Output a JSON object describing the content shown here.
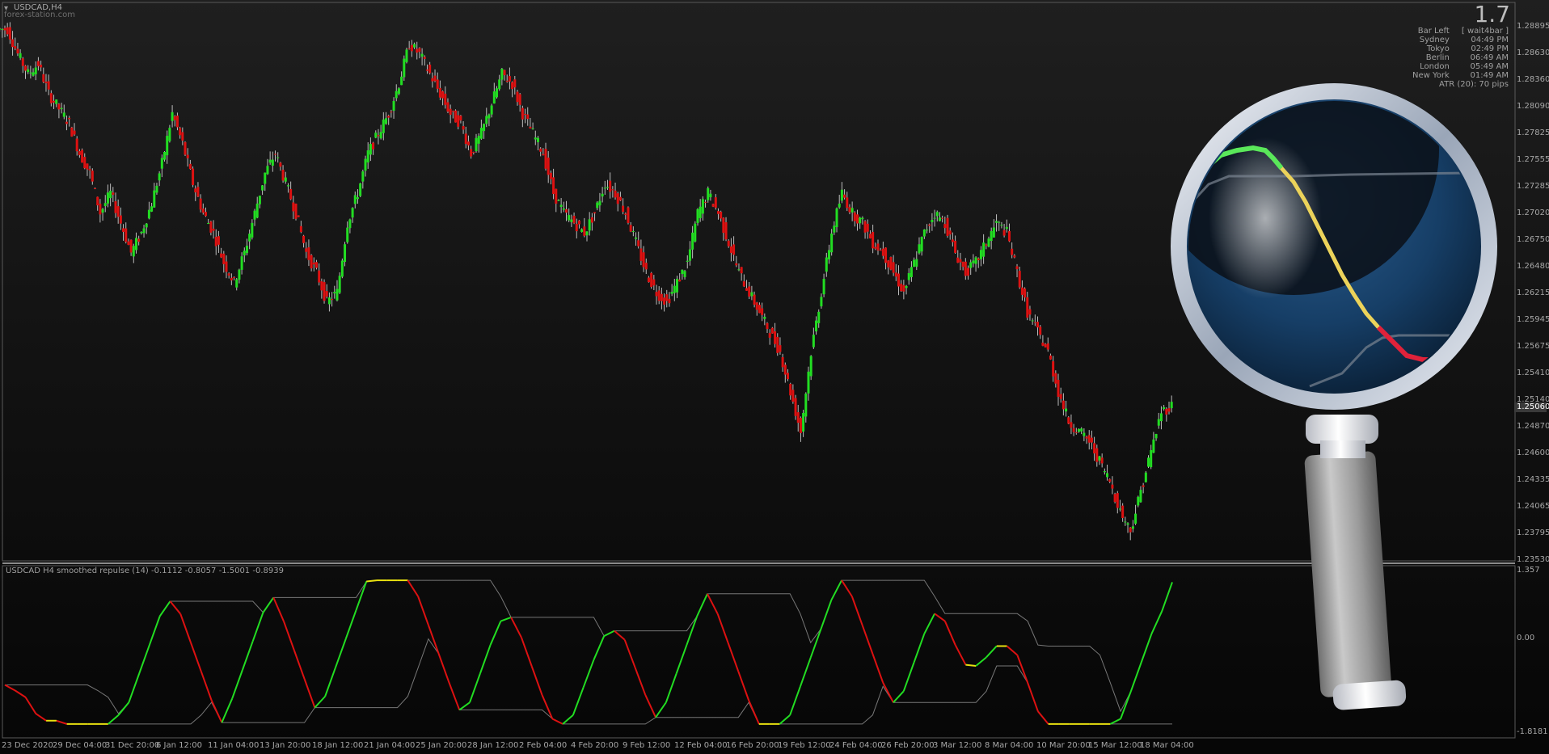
{
  "window": {
    "symbol_title": "USDCAD,H4",
    "watermark": "forex-station.com",
    "countdown": "1.7",
    "current_price": "1.25060"
  },
  "info_panel": [
    {
      "label": "Bar Left",
      "value": "[ wait4bar ]"
    },
    {
      "label": "Sydney",
      "value": "04:49 PM"
    },
    {
      "label": "Tokyo",
      "value": "02:49 PM"
    },
    {
      "label": "Berlin",
      "value": "06:49 AM"
    },
    {
      "label": "London",
      "value": "05:49 AM"
    },
    {
      "label": "New York",
      "value": "01:49 AM"
    }
  ],
  "atr_text": "ATR (20): 70 pips",
  "price_axis": [
    "1.28895",
    "1.28630",
    "1.28360",
    "1.28090",
    "1.27825",
    "1.27555",
    "1.27285",
    "1.27020",
    "1.26750",
    "1.26480",
    "1.26215",
    "1.25945",
    "1.25675",
    "1.25410",
    "1.25140",
    "1.24870",
    "1.24600",
    "1.24335",
    "1.24065",
    "1.23795",
    "1.23530"
  ],
  "indicator": {
    "title": "USDCAD H4 smoothed repulse (14) -0.1112 -0.8057 -1.5001 -0.8939",
    "axis": [
      "1.357",
      "0.00",
      "-1.8181"
    ]
  },
  "time_axis": [
    "23 Dec 2020",
    "29 Dec 04:00",
    "31 Dec 20:00",
    "6 Jan 12:00",
    "11 Jan 04:00",
    "13 Jan 20:00",
    "18 Jan 12:00",
    "21 Jan 04:00",
    "25 Jan 20:00",
    "28 Jan 12:00",
    "2 Feb 04:00",
    "4 Feb 20:00",
    "9 Feb 12:00",
    "12 Feb 04:00",
    "16 Feb 20:00",
    "19 Feb 12:00",
    "24 Feb 04:00",
    "26 Feb 20:00",
    "3 Mar 12:00",
    "8 Mar 04:00",
    "10 Mar 20:00",
    "15 Mar 12:00",
    "18 Mar 04:00"
  ],
  "colors": {
    "bull": "#22dd22",
    "bear": "#dd1111",
    "neutral": "#e8e010",
    "axis_text": "#a7a7a7",
    "lens_blue": "#1b4770"
  },
  "icons": {
    "collapse": "triangle-down-icon",
    "overlay": "magnifying-glass-icon"
  },
  "chart_data": {
    "type": "candlestick",
    "symbol": "USDCAD",
    "timeframe": "H4",
    "price_range": [
      1.2353,
      1.289
    ],
    "last_price": 1.2506,
    "closes": [
      1.2885,
      1.286,
      1.284,
      1.285,
      1.282,
      1.2805,
      1.279,
      1.276,
      1.274,
      1.27,
      1.272,
      1.269,
      1.266,
      1.268,
      1.271,
      1.275,
      1.28,
      1.277,
      1.273,
      1.27,
      1.268,
      1.265,
      1.263,
      1.266,
      1.27,
      1.274,
      1.276,
      1.273,
      1.27,
      1.266,
      1.264,
      1.261,
      1.262,
      1.269,
      1.272,
      1.276,
      1.278,
      1.28,
      1.283,
      1.287,
      1.286,
      1.284,
      1.282,
      1.28,
      1.279,
      1.276,
      1.278,
      1.281,
      1.284,
      1.283,
      1.28,
      1.278,
      1.276,
      1.272,
      1.27,
      1.269,
      1.268,
      1.27,
      1.273,
      1.272,
      1.27,
      1.267,
      1.264,
      1.262,
      1.261,
      1.263,
      1.265,
      1.27,
      1.272,
      1.27,
      1.267,
      1.264,
      1.262,
      1.26,
      1.258,
      1.256,
      1.252,
      1.248,
      1.256,
      1.262,
      1.268,
      1.272,
      1.27,
      1.269,
      1.267,
      1.266,
      1.264,
      1.262,
      1.265,
      1.268,
      1.27,
      1.269,
      1.266,
      1.264,
      1.265,
      1.267,
      1.269,
      1.268,
      1.264,
      1.26,
      1.258,
      1.256,
      1.252,
      1.249,
      1.248,
      1.247,
      1.245,
      1.243,
      1.24,
      1.238,
      1.242,
      1.246,
      1.25,
      1.2506
    ],
    "oscillator": {
      "name": "smoothed repulse (14)",
      "values_shown": [
        -0.1112,
        -0.8057,
        -1.5001,
        -0.8939
      ],
      "range": [
        -1.8181,
        1.357
      ]
    }
  }
}
